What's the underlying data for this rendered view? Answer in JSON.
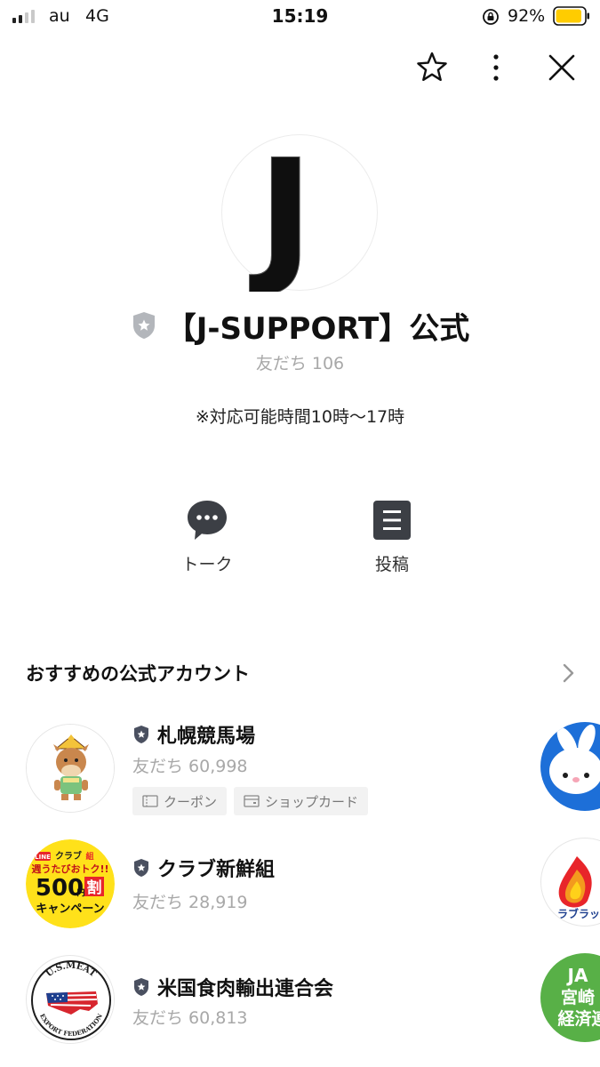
{
  "status_bar": {
    "carrier": "au",
    "network": "4G",
    "time": "15:19",
    "battery_percent": "92%",
    "battery_level": 0.92
  },
  "toolbar": {
    "icons": [
      "star-icon",
      "more-vertical-icon",
      "close-icon"
    ]
  },
  "profile": {
    "avatar_letter": "J",
    "name": "【J-SUPPORT】公式",
    "friends": "友だち 106",
    "description": "※対応可能時間10時〜17時"
  },
  "actions": [
    {
      "label": "トーク",
      "icon": "chat-bubble-icon"
    },
    {
      "label": "投稿",
      "icon": "post-list-icon"
    }
  ],
  "recommended": {
    "title": "おすすめの公式アカウント",
    "items": [
      {
        "name": "札幌競馬場",
        "friends": "友だち 60,998",
        "tags": [
          {
            "label": "クーポン",
            "icon": "coupon-icon"
          },
          {
            "label": "ショップカード",
            "icon": "shop-card-icon"
          }
        ]
      },
      {
        "name": "クラブ新鮮組",
        "friends": "友だち 28,919",
        "logo_text": {
          "line1": "LINE",
          "line2": "クラブ",
          "line3": "組",
          "line4": "週うたびおトク!!",
          "line5": "500",
          "line6": "円",
          "line7": "割",
          "line8": "キャンペーン"
        }
      },
      {
        "name": "米国食肉輸出連合会",
        "friends": "友だち 60,813",
        "logo_text": {
          "top": "U.S.MEAT",
          "bottom": "EXPORT FEDERATION"
        }
      }
    ],
    "side_logos": [
      {
        "icon": "rabbit-logo-icon"
      },
      {
        "text": "ラブラッ",
        "icon": "flame-logo-icon"
      },
      {
        "text1": "JA",
        "text2": "宮崎",
        "text3": "経済連"
      }
    ]
  },
  "colors": {
    "text_primary": "#111111",
    "text_muted": "#a8a8a8",
    "icon_dark": "#3c3f45",
    "tag_bg": "#f2f2f2",
    "battery_fill": "#ffcc00",
    "badge_grey": "#b3b6bb",
    "badge_navy": "#4a5060"
  }
}
